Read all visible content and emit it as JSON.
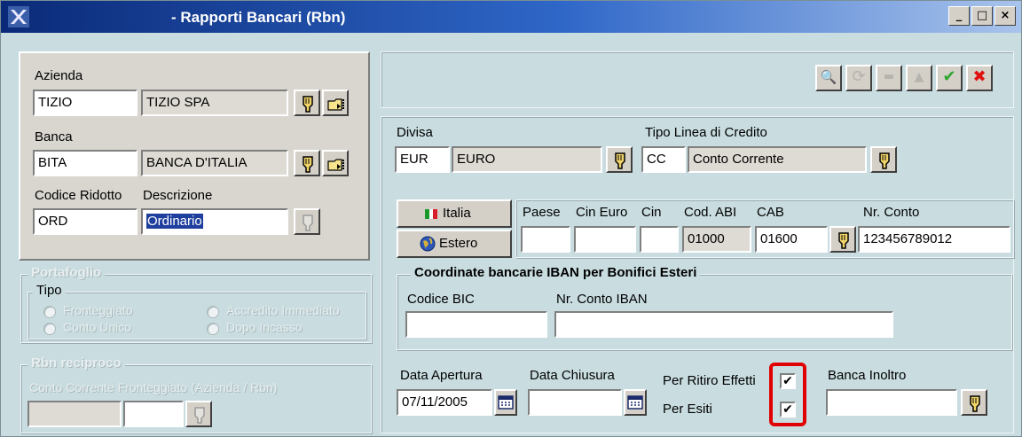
{
  "window": {
    "title": "- Rapporti Bancari (Rbn)",
    "controls": [
      "_",
      "□",
      "×"
    ]
  },
  "toolbar": {
    "buttons": [
      {
        "name": "zoom",
        "glyph": "🔍",
        "enabled": false
      },
      {
        "name": "refresh",
        "glyph": "⟳",
        "enabled": false
      },
      {
        "name": "minus",
        "glyph": "▬",
        "enabled": false
      },
      {
        "name": "up",
        "glyph": "▲",
        "enabled": false
      },
      {
        "name": "confirm",
        "glyph": "✔",
        "enabled": true,
        "color": "#2fa52f"
      },
      {
        "name": "cancel",
        "glyph": "✖",
        "enabled": true,
        "color": "#e01010"
      }
    ]
  },
  "left": {
    "azienda": {
      "label": "Azienda",
      "code": "TIZIO",
      "name": "TIZIO SPA"
    },
    "banca": {
      "label": "Banca",
      "code": "BITA",
      "name": "BANCA D'ITALIA"
    },
    "codice_ridotto": {
      "label": "Codice Ridotto",
      "value": "ORD"
    },
    "descrizione": {
      "label": "Descrizione",
      "value": "Ordinario"
    },
    "portafoglio": {
      "title": "Portafoglio",
      "tipo": "Tipo",
      "options": [
        "Fronteggiato",
        "Conto Unico",
        "Accredito Immediato",
        "Dopo Incasso"
      ]
    },
    "rbn_reciproco": {
      "title": "Rbn reciproco",
      "caption": "Conto Corrente Fronteggiato (Azienda / Rbn)"
    }
  },
  "right": {
    "divisa": {
      "label": "Divisa",
      "code": "EUR",
      "name": "EURO"
    },
    "tipo_linea": {
      "label": "Tipo Linea di Credito",
      "code": "CC",
      "name": "Conto Corrente"
    },
    "buttons": {
      "italia": "Italia",
      "estero": "Estero"
    },
    "coord": {
      "paese": {
        "label": "Paese",
        "value": ""
      },
      "cin_euro": {
        "label": "Cin Euro",
        "value": ""
      },
      "cin": {
        "label": "Cin",
        "value": ""
      },
      "abi": {
        "label": "Cod. ABI",
        "value": "01000"
      },
      "cab": {
        "label": "CAB",
        "value": "01600"
      },
      "conto": {
        "label": "Nr. Conto",
        "value": "123456789012"
      }
    },
    "iban": {
      "title": "Coordinate bancarie IBAN per Bonifici Esteri",
      "bic_label": "Codice BIC",
      "bic_value": "",
      "iban_label": "Nr. Conto IBAN",
      "iban_value": ""
    },
    "data_apertura": {
      "label": "Data Apertura",
      "value": "07/11/2005"
    },
    "data_chiusura": {
      "label": "Data Chiusura",
      "value": ""
    },
    "per_ritiro": {
      "label": "Per Ritiro Effetti",
      "checked": true
    },
    "per_esiti": {
      "label": "Per Esiti",
      "checked": true
    },
    "banca_inoltro": {
      "label": "Banca Inoltro",
      "value": ""
    }
  }
}
